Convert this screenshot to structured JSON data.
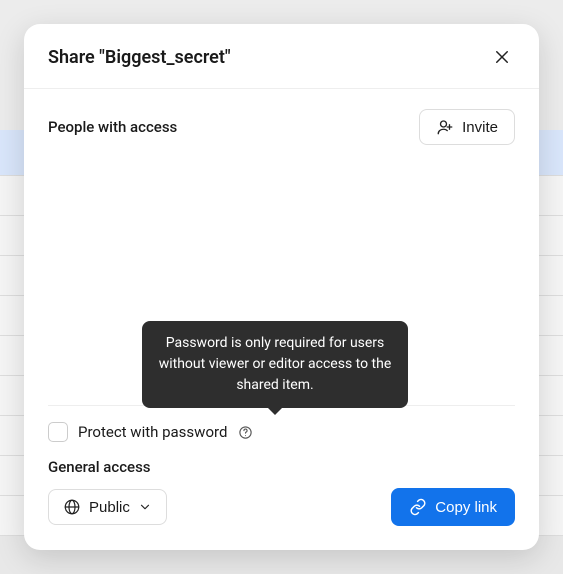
{
  "modal": {
    "title": "Share \"Biggest_secret\""
  },
  "people": {
    "label": "People with access",
    "invite_label": "Invite"
  },
  "protect": {
    "label": "Protect with password",
    "tooltip": "Password is only required for users without viewer or editor access to the shared item."
  },
  "general": {
    "label": "General access",
    "visibility_label": "Public",
    "copy_label": "Copy link"
  }
}
